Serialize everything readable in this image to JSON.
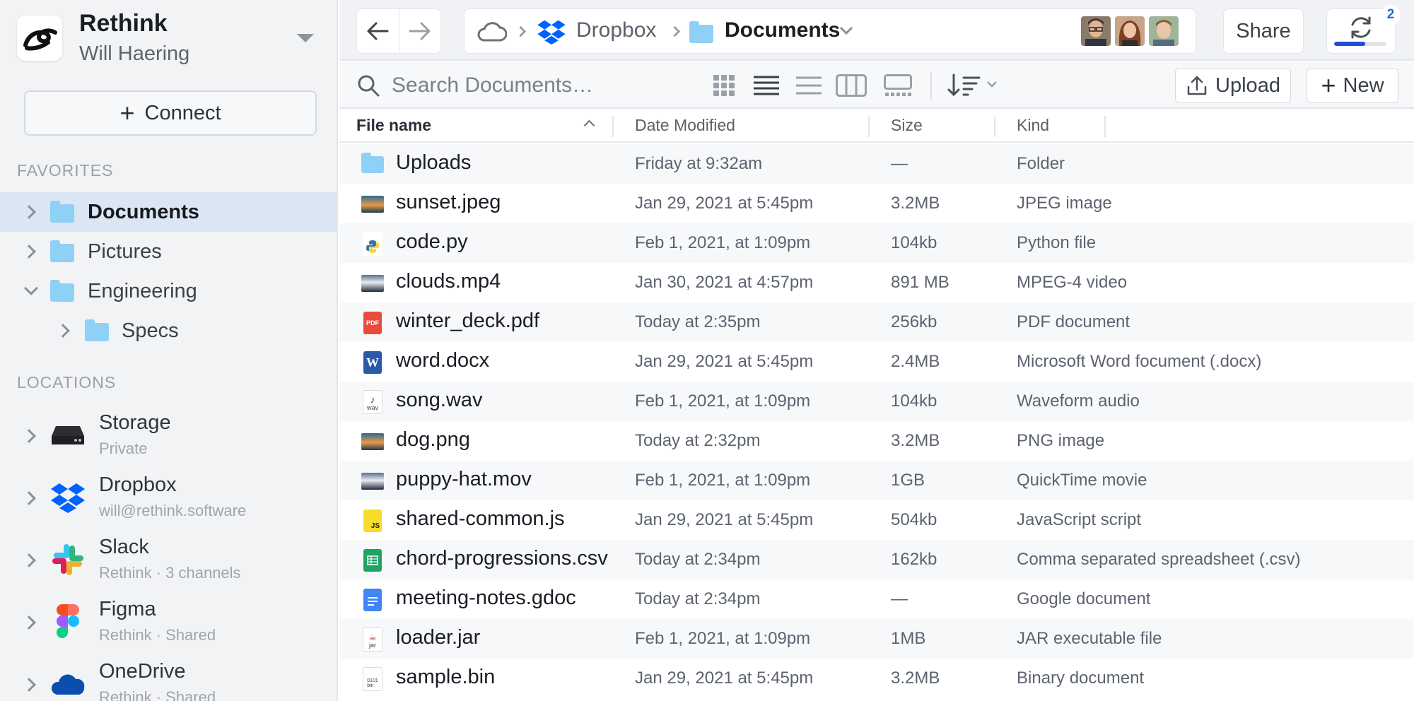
{
  "account": {
    "app_name": "Rethink",
    "user_name": "Will Haering"
  },
  "sidebar": {
    "connect_label": "Connect",
    "favorites_title": "FAVORITES",
    "favorites": [
      {
        "label": "Documents",
        "selected": true,
        "expanded": false,
        "indent": 0
      },
      {
        "label": "Pictures",
        "selected": false,
        "expanded": false,
        "indent": 0
      },
      {
        "label": "Engineering",
        "selected": false,
        "expanded": true,
        "indent": 0
      },
      {
        "label": "Specs",
        "selected": false,
        "expanded": false,
        "indent": 1
      }
    ],
    "locations_title": "LOCATIONS",
    "locations": [
      {
        "name": "Storage",
        "sub": "Private",
        "icon": "hard-drive-icon"
      },
      {
        "name": "Dropbox",
        "sub": "will@rethink.software",
        "icon": "dropbox-icon"
      },
      {
        "name": "Slack",
        "sub": "Rethink · 3 channels",
        "icon": "slack-icon"
      },
      {
        "name": "Figma",
        "sub": "Rethink · Shared",
        "icon": "figma-icon"
      },
      {
        "name": "OneDrive",
        "sub": "Rethink · Shared",
        "icon": "onedrive-icon"
      }
    ]
  },
  "header": {
    "breadcrumb": [
      "Dropbox",
      "Documents"
    ],
    "share_label": "Share",
    "sync_count": "2",
    "sync_progress": 0.6,
    "colors": {
      "accent": "#1f4fd1",
      "folder": "#8fd0f7",
      "dropbox": "#0061fe"
    }
  },
  "toolbar": {
    "search_placeholder": "Search Documents…",
    "upload_label": "Upload",
    "new_label": "New"
  },
  "table": {
    "columns": [
      "File name",
      "Date Modified",
      "Size",
      "Kind"
    ],
    "rows": [
      {
        "name": "Uploads",
        "date": "Friday at 9:32am",
        "size": "—",
        "kind": "Folder",
        "icon": "folder-icon"
      },
      {
        "name": "sunset.jpeg",
        "date": "Jan 29, 2021 at 5:45pm",
        "size": "3.2MB",
        "kind": "JPEG image",
        "icon": "image-icon"
      },
      {
        "name": "code.py",
        "date": "Feb 1, 2021, at 1:09pm",
        "size": "104kb",
        "kind": "Python file",
        "icon": "python-file-icon"
      },
      {
        "name": "clouds.mp4",
        "date": "Jan 30, 2021 at 4:57pm",
        "size": "891 MB",
        "kind": "MPEG-4 video",
        "icon": "video-icon"
      },
      {
        "name": "winter_deck.pdf",
        "date": "Today at 2:35pm",
        "size": "256kb",
        "kind": "PDF document",
        "icon": "pdf-icon"
      },
      {
        "name": "word.docx",
        "date": "Jan 29, 2021 at 5:45pm",
        "size": "2.4MB",
        "kind": "Microsoft Word focument (.docx)",
        "icon": "word-icon"
      },
      {
        "name": "song.wav",
        "date": "Feb 1, 2021, at 1:09pm",
        "size": "104kb",
        "kind": "Waveform audio",
        "icon": "audio-file-icon"
      },
      {
        "name": "dog.png",
        "date": "Today at 2:32pm",
        "size": "3.2MB",
        "kind": "PNG image",
        "icon": "image-icon"
      },
      {
        "name": "puppy-hat.mov",
        "date": "Feb 1, 2021, at 1:09pm",
        "size": "1GB",
        "kind": "QuickTime movie",
        "icon": "video-icon"
      },
      {
        "name": "shared-common.js",
        "date": "Jan 29, 2021 at 5:45pm",
        "size": "504kb",
        "kind": "JavaScript script",
        "icon": "js-file-icon"
      },
      {
        "name": "chord-progressions.csv",
        "date": "Today at 2:34pm",
        "size": "162kb",
        "kind": "Comma separated spreadsheet (.csv)",
        "icon": "csv-file-icon"
      },
      {
        "name": "meeting-notes.gdoc",
        "date": "Today at 2:34pm",
        "size": "—",
        "kind": "Google document",
        "icon": "gdoc-icon"
      },
      {
        "name": "loader.jar",
        "date": "Feb 1, 2021, at 1:09pm",
        "size": "1MB",
        "kind": "JAR executable file",
        "icon": "jar-file-icon"
      },
      {
        "name": "sample.bin",
        "date": "Jan 29, 2021 at 5:45pm",
        "size": "3.2MB",
        "kind": "Binary document",
        "icon": "binary-file-icon"
      }
    ]
  }
}
